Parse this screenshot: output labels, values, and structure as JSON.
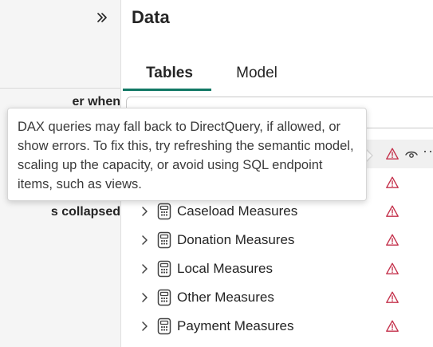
{
  "left_pane": {
    "expand_icon": "chevron-double-right-icon",
    "text_1": "er when",
    "text_2": "s collapsed"
  },
  "data_pane": {
    "title": "Data",
    "tabs": [
      {
        "label": "Tables",
        "selected": true
      },
      {
        "label": "Model",
        "selected": false
      }
    ],
    "accent_color": "#117865",
    "warning_color": "#c4314b",
    "items": [
      {
        "label": "",
        "icon": "calculator-icon",
        "warning": true,
        "hovered": true
      },
      {
        "label": "",
        "icon": "calculator-icon",
        "warning": true,
        "hovered": false
      },
      {
        "label": "Caseload Measures",
        "icon": "calculator-icon",
        "warning": true,
        "hovered": false
      },
      {
        "label": "Donation Measures",
        "icon": "calculator-icon",
        "warning": true,
        "hovered": false
      },
      {
        "label": "Local Measures",
        "icon": "calculator-icon",
        "warning": true,
        "hovered": false
      },
      {
        "label": "Other Measures",
        "icon": "calculator-icon",
        "warning": true,
        "hovered": false
      },
      {
        "label": "Payment Measures",
        "icon": "calculator-icon",
        "warning": true,
        "hovered": false
      }
    ],
    "more_label": "···"
  },
  "tooltip": {
    "text": "DAX queries may fall back to DirectQuery, if allowed, or show errors. To fix this, try refreshing the semantic model, scaling up the capacity, or avoid using SQL endpoint items, such as views."
  }
}
